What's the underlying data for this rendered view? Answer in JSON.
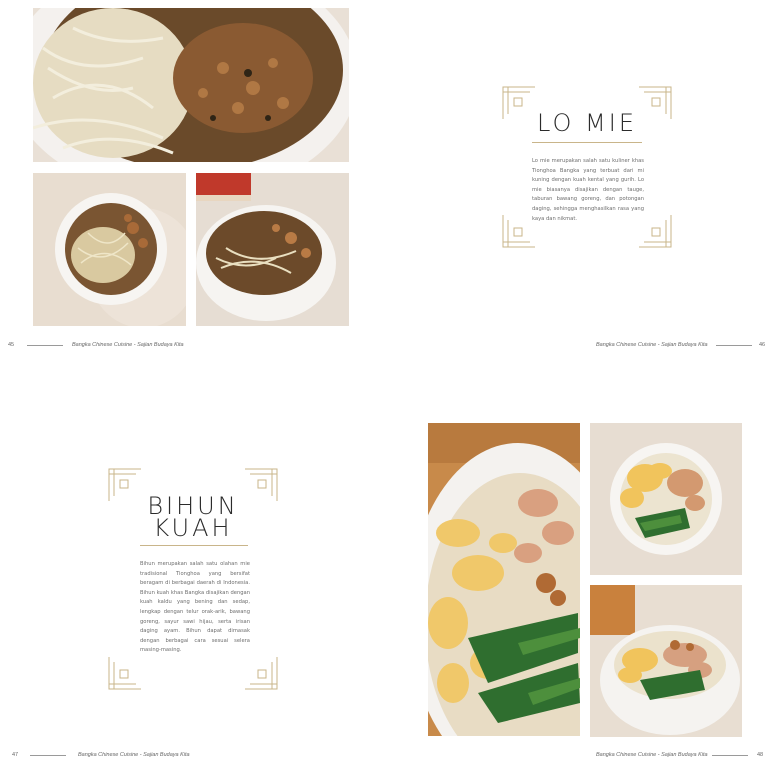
{
  "spread_top": {
    "title": "LO MIE",
    "description": "Lo mie merupakan salah satu kuliner khas Tionghoa Bangka yang terbuat dari mi kuning dengan kuah kental yang gurih. Lo mie biasanya disajikan dengan tauge, taburan bawang goreng, dan potongan daging, sehingga menghasilkan rasa yang kaya dan nikmat.",
    "footer_left": "Bangka Chinese Cuisine - Sajian Budaya Kita",
    "footer_right": "Bangka Chinese Cuisine - Sajian Budaya Kita",
    "page_left": "45",
    "page_right": "46"
  },
  "spread_bottom": {
    "title_line1": "BIHUN",
    "title_line2": "KUAH",
    "description": "Bihun merupakan salah satu olahan mie tradisional Tionghoa yang bersifat beragam di berbagai daerah di Indonesia. Bihun kuah khas Bangka disajikan dengan kuah kaldu yang bening dan sedap, lengkap dengan telur orak-arik, bawang goreng, sayur sawi hijau, serta irisan daging ayam. Bihun dapat dimasak dengan berbagai cara sesuai selera masing-masing.",
    "footer_left": "Bangka Chinese Cuisine - Sajian Budaya Kita",
    "footer_right": "Bangka Chinese Cuisine - Sajian Budaya Kita",
    "page_left": "47",
    "page_right": "48"
  },
  "colors": {
    "accent_gold": "#c9b58a",
    "text_dark": "#2b2b2b",
    "text_body": "#6d6d6d"
  }
}
